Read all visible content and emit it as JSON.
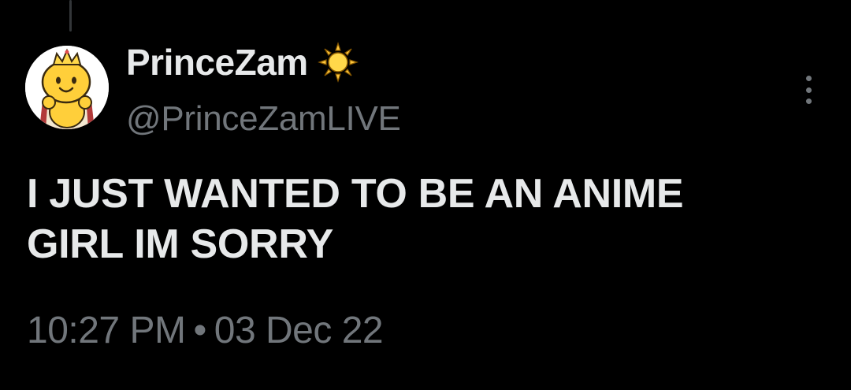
{
  "tweet": {
    "author": {
      "display_name": "PrinceZam",
      "name_emoji_icon": "sun-icon",
      "handle": "@PrinceZamLIVE",
      "avatar_icon": "crowned-yellow-character-avatar"
    },
    "text": "I JUST WANTED TO BE AN ANIME\nGIRL IM SORRY",
    "time": "10:27 PM",
    "separator": "•",
    "date": "03 Dec 22",
    "more_menu_icon": "more-vertical-icon"
  },
  "colors": {
    "background": "#000000",
    "primary_text": "#e7e9ea",
    "secondary_text": "#71767b",
    "sun_yellow": "#ffc83d"
  }
}
